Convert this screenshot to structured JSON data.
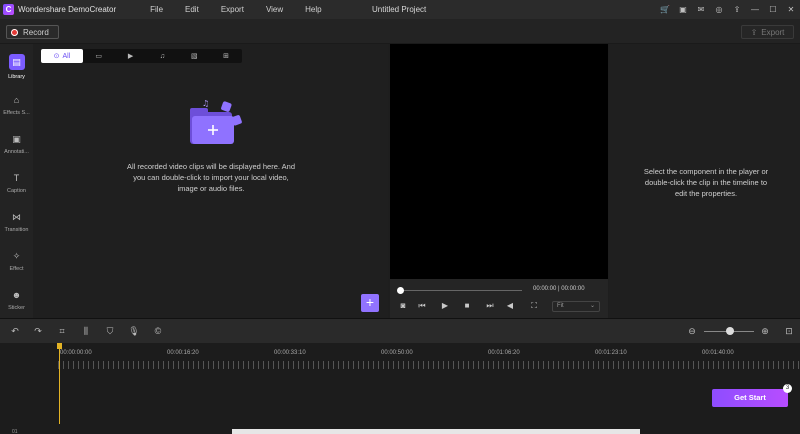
{
  "app": {
    "logo_glyph": "C",
    "name": "Wondershare DemoCreator",
    "project_title": "Untitled Project"
  },
  "menu": [
    "File",
    "Edit",
    "Export",
    "View",
    "Help"
  ],
  "record": {
    "label": "Record"
  },
  "export": {
    "label": "Export"
  },
  "sidebar": {
    "items": [
      {
        "label": "Library",
        "icon": "library-icon",
        "glyph": "▤"
      },
      {
        "label": "Effects S...",
        "icon": "effects-store-icon",
        "glyph": "⌂"
      },
      {
        "label": "Annotati...",
        "icon": "annotation-icon",
        "glyph": "▣"
      },
      {
        "label": "Caption",
        "icon": "caption-icon",
        "glyph": "T"
      },
      {
        "label": "Transition",
        "icon": "transition-icon",
        "glyph": "⋈"
      },
      {
        "label": "Effect",
        "icon": "effect-icon",
        "glyph": "✧"
      },
      {
        "label": "Sticker",
        "icon": "sticker-icon",
        "glyph": "☻"
      }
    ]
  },
  "media": {
    "filters": [
      {
        "label": "All",
        "icon": "all-icon",
        "glyph": "⊙"
      },
      {
        "label": "",
        "icon": "video-icon",
        "glyph": "▭"
      },
      {
        "label": "",
        "icon": "screen-icon",
        "glyph": "▶"
      },
      {
        "label": "",
        "icon": "music-icon",
        "glyph": "♫"
      },
      {
        "label": "",
        "icon": "image-icon",
        "glyph": "▧"
      },
      {
        "label": "",
        "icon": "grid-icon",
        "glyph": "⊞"
      }
    ],
    "empty_line1": "All recorded video clips will be displayed here. And",
    "empty_line2": "you can double-click to import your local video,",
    "empty_line3": "image or audio files.",
    "add_glyph": "+"
  },
  "player": {
    "timecode": "00:00:00 | 00:00:00",
    "fit": "Fit",
    "progress": 0
  },
  "properties": {
    "line1": "Select the component in the player or",
    "line2": "double-click the clip in the timeline to",
    "line3": "edit the properties."
  },
  "timeline": {
    "ticks": [
      "00:00:00:00",
      "00:00:16:20",
      "00:00:33:10",
      "00:00:50:00",
      "00:01:06:20",
      "00:01:23:10",
      "00:01:40:00"
    ],
    "get_start": "Get Start",
    "badge": "3",
    "bottom_label": "01"
  },
  "colors": {
    "accent": "#7b5cff",
    "record": "#e53935",
    "playhead": "#e3b325"
  }
}
